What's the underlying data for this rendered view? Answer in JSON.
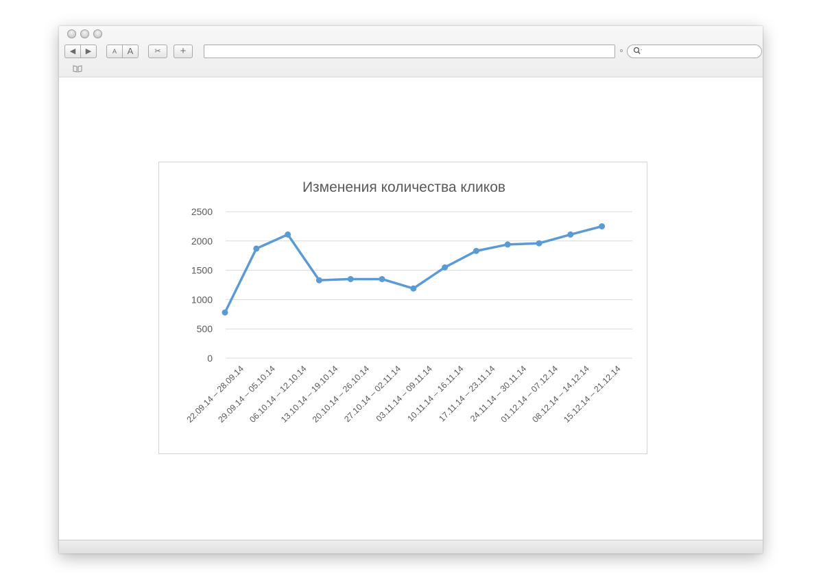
{
  "window": {
    "toolbar": {
      "back_icon": "◀",
      "forward_icon": "▶",
      "text_smaller": "A",
      "text_bigger": "A",
      "clip_icon": "✂",
      "add_icon": "+",
      "url": ""
    },
    "search": {
      "placeholder": ""
    },
    "bookmarks_icon": "book-icon"
  },
  "chart_data": {
    "type": "line",
    "title": "Изменения количества кликов",
    "xlabel": "",
    "ylabel": "",
    "ylim": [
      0,
      2500
    ],
    "yticks": [
      0,
      500,
      1000,
      1500,
      2000,
      2500
    ],
    "ytick_labels": [
      "0",
      "500",
      "1000",
      "1500",
      "2000",
      "2500"
    ],
    "grid": true,
    "legend": "none",
    "color": "#5B9BD5",
    "categories": [
      "22.09.14 – 28.09.14",
      "29.09.14 – 05.10.14",
      "06.10.14 – 12.10.14",
      "13.10.14 – 19.10.14",
      "20.10.14 – 26.10.14",
      "27.10.14 – 02.11.14",
      "03.11.14 – 09.11.14",
      "10.11.14 – 16.11.14",
      "17.11.14 – 23.11.14",
      "24.11.14 – 30.11.14",
      "01.12.14 – 07.12.14",
      "08.12.14 – 14.12.14",
      "15.12.14 – 21.12.14"
    ],
    "series": [
      {
        "values": [
          780,
          1870,
          2110,
          1330,
          1350,
          1350,
          1190,
          1550,
          1830,
          1940,
          1960,
          2110,
          2250
        ]
      }
    ]
  }
}
